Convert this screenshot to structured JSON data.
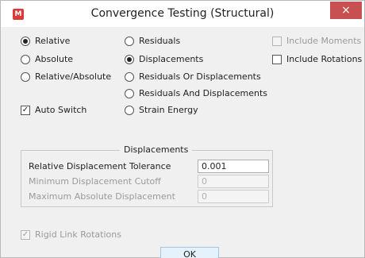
{
  "window": {
    "title": "Convergence Testing (Structural)",
    "app_icon": "M",
    "close_glyph": "×"
  },
  "convergence_mode": {
    "options": [
      {
        "label": "Relative",
        "selected": true
      },
      {
        "label": "Absolute",
        "selected": false
      },
      {
        "label": "Relative/Absolute",
        "selected": false
      }
    ]
  },
  "convergence_criteria": {
    "options": [
      {
        "label": "Residuals",
        "selected": false
      },
      {
        "label": "Displacements",
        "selected": true
      },
      {
        "label": "Residuals Or Displacements",
        "selected": false
      },
      {
        "label": "Residuals And Displacements",
        "selected": false
      },
      {
        "label": "Strain Energy",
        "selected": false
      }
    ]
  },
  "include": {
    "moments": {
      "label": "Include Moments",
      "checked": false,
      "enabled": false
    },
    "rotations": {
      "label": "Include Rotations",
      "checked": false,
      "enabled": true
    }
  },
  "auto_switch": {
    "label": "Auto Switch",
    "checked": true
  },
  "displacements_group": {
    "title": "Displacements",
    "fields": [
      {
        "label": "Relative Displacement Tolerance",
        "value": "0.001",
        "enabled": true
      },
      {
        "label": "Minimum Displacement Cutoff",
        "value": "0",
        "enabled": false
      },
      {
        "label": "Maximum Absolute Displacement",
        "value": "0",
        "enabled": false
      }
    ]
  },
  "rigid_link": {
    "label": "Rigid Link Rotations",
    "checked": true,
    "enabled": false
  },
  "ok_button": {
    "label": "OK"
  },
  "colors": {
    "close_button": "#c75050",
    "app_icon": "#d93a3a",
    "ok_border": "#9fc6e6"
  }
}
